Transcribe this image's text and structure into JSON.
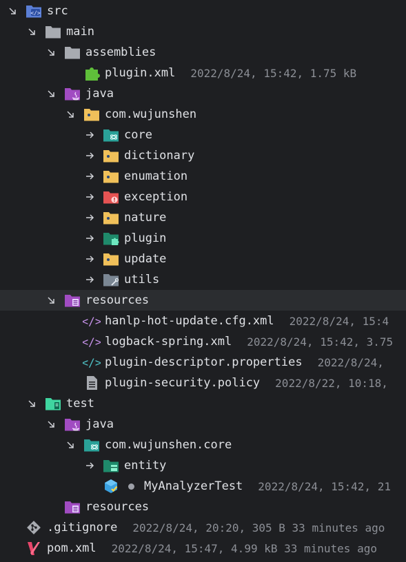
{
  "tree": {
    "rows": [
      {
        "label": "src",
        "meta": "",
        "icon": "source-folder-icon",
        "arrow": "expanded",
        "depth": 0
      },
      {
        "label": "main",
        "meta": "",
        "icon": "folder-gray-icon",
        "arrow": "expanded",
        "depth": 1
      },
      {
        "label": "assemblies",
        "meta": "",
        "icon": "folder-gray-icon",
        "arrow": "expanded",
        "depth": 2
      },
      {
        "label": "plugin.xml",
        "meta": "2022/8/24, 15:42, 1.75 kB",
        "icon": "plugin-file-icon",
        "arrow": "none",
        "depth": 3
      },
      {
        "label": "java",
        "meta": "",
        "icon": "java-source-folder-icon",
        "arrow": "expanded",
        "depth": 2
      },
      {
        "label": "com.wujunshen",
        "meta": "",
        "icon": "package-folder-icon",
        "arrow": "expanded",
        "depth": 3
      },
      {
        "label": "core",
        "meta": "",
        "icon": "core-package-icon",
        "arrow": "collapsed",
        "depth": 4
      },
      {
        "label": "dictionary",
        "meta": "",
        "icon": "package-folder-icon",
        "arrow": "collapsed",
        "depth": 4
      },
      {
        "label": "enumation",
        "meta": "",
        "icon": "package-folder-icon",
        "arrow": "collapsed",
        "depth": 4
      },
      {
        "label": "exception",
        "meta": "",
        "icon": "exception-package-icon",
        "arrow": "collapsed",
        "depth": 4
      },
      {
        "label": "nature",
        "meta": "",
        "icon": "package-folder-icon",
        "arrow": "collapsed",
        "depth": 4
      },
      {
        "label": "plugin",
        "meta": "",
        "icon": "plugin-package-icon",
        "arrow": "collapsed",
        "depth": 4
      },
      {
        "label": "update",
        "meta": "",
        "icon": "package-folder-icon",
        "arrow": "collapsed",
        "depth": 4
      },
      {
        "label": "utils",
        "meta": "",
        "icon": "utils-package-icon",
        "arrow": "collapsed",
        "depth": 4
      },
      {
        "label": "resources",
        "meta": "",
        "icon": "resources-folder-icon",
        "arrow": "expanded",
        "depth": 2,
        "selected": true
      },
      {
        "label": "hanlp-hot-update.cfg.xml",
        "meta": "2022/8/24, 15:4",
        "icon": "xml-file-icon",
        "arrow": "none",
        "depth": 3
      },
      {
        "label": "logback-spring.xml",
        "meta": "2022/8/24, 15:42, 3.75",
        "icon": "xml-file-icon",
        "arrow": "none",
        "depth": 3
      },
      {
        "label": "plugin-descriptor.properties",
        "meta": "2022/8/24,",
        "icon": "properties-file-icon",
        "arrow": "none",
        "depth": 3
      },
      {
        "label": "plugin-security.policy",
        "meta": "2022/8/22, 10:18,",
        "icon": "text-file-icon",
        "arrow": "none",
        "depth": 3
      },
      {
        "label": "test",
        "meta": "",
        "icon": "test-folder-icon",
        "arrow": "expanded",
        "depth": 1
      },
      {
        "label": "java",
        "meta": "",
        "icon": "java-source-folder-icon",
        "arrow": "expanded",
        "depth": 2
      },
      {
        "label": "com.wujunshen.core",
        "meta": "",
        "icon": "core-package-icon",
        "arrow": "expanded",
        "depth": 3
      },
      {
        "label": "entity",
        "meta": "",
        "icon": "entity-package-icon",
        "arrow": "collapsed",
        "depth": 4
      },
      {
        "label": "MyAnalyzerTest",
        "meta": "2022/8/24, 15:42, 21",
        "icon": "test-class-icon",
        "arrow": "none",
        "depth": 4,
        "dot": true
      },
      {
        "label": "resources",
        "meta": "",
        "icon": "resources-folder-icon",
        "arrow": "none",
        "depth": 2
      },
      {
        "label": ".gitignore",
        "meta": "2022/8/24, 20:20, 305 B 33 minutes ago",
        "icon": "git-file-icon",
        "arrow": "none",
        "depth": 0
      },
      {
        "label": "pom.xml",
        "meta": "2022/8/24, 15:47, 4.99 kB 33 minutes ago",
        "icon": "maven-file-icon",
        "arrow": "none",
        "depth": 0
      }
    ]
  },
  "colors": {
    "background": "#1e1f22",
    "selected_row": "#2b2d30",
    "folder_gray": "#a8abb1",
    "folder_yellow": "#f0c05a",
    "source_blue": "#5b7fd6",
    "java_purple": "#a14cc2",
    "test_green": "#3fd5a0",
    "exception_red": "#e65353",
    "teal": "#2aa198",
    "meta_text": "#8c8f96"
  }
}
